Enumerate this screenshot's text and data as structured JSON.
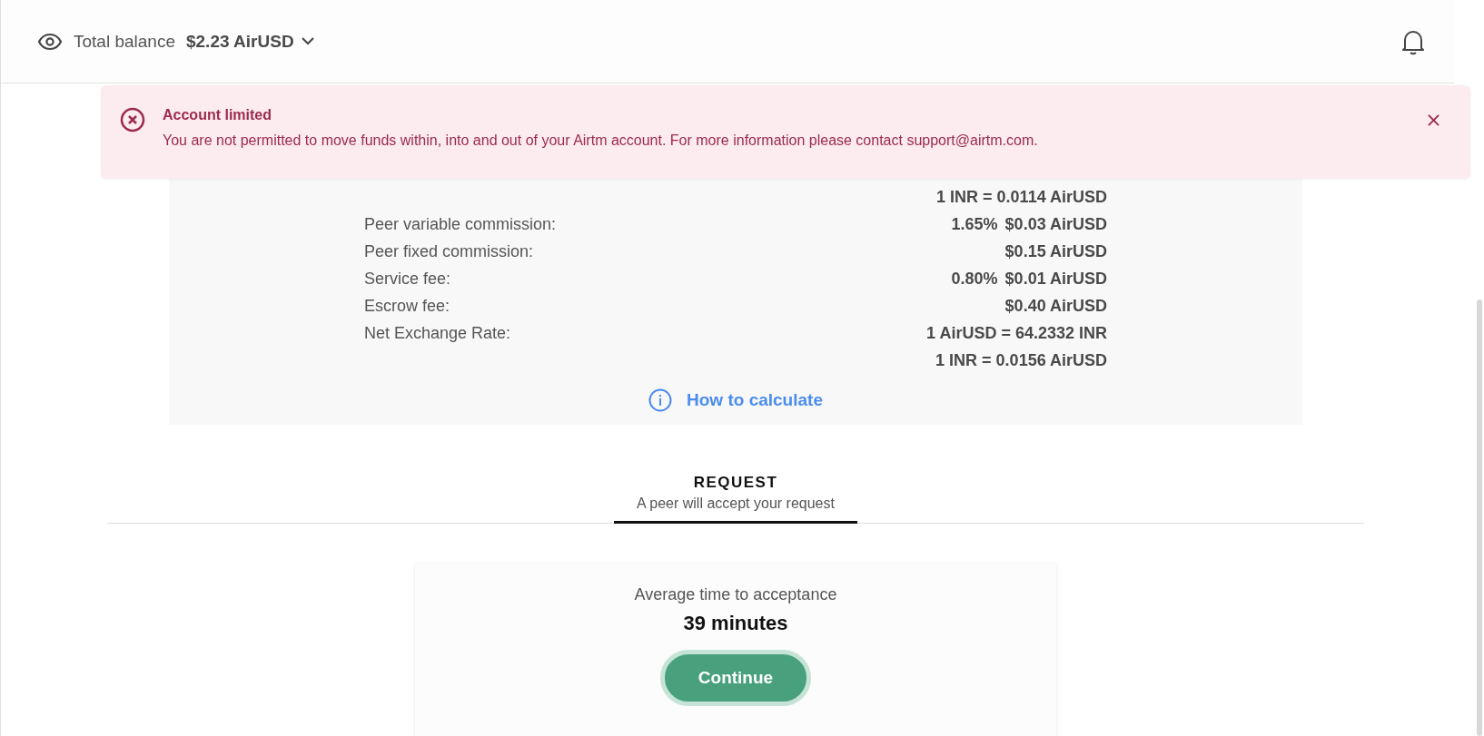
{
  "header": {
    "balance_label": "Total balance",
    "balance_value": "$2.23 AirUSD"
  },
  "alert": {
    "title": "Account limited",
    "message": "You are not permitted to move funds within, into and out of your Airtm account. For more information please contact support@airtm.com."
  },
  "fees": {
    "rows": [
      {
        "label": "",
        "values": [
          "1 INR = 0.0114 AirUSD"
        ]
      },
      {
        "label": "Peer variable commission:",
        "values": [
          "1.65%",
          "$0.03 AirUSD"
        ]
      },
      {
        "label": "Peer fixed commission:",
        "values": [
          "$0.15 AirUSD"
        ]
      },
      {
        "label": "Service fee:",
        "values": [
          "0.80%",
          "$0.01 AirUSD"
        ]
      },
      {
        "label": "Escrow fee:",
        "values": [
          "$0.40 AirUSD"
        ]
      },
      {
        "label": "Net Exchange Rate:",
        "values": [
          "1 AirUSD = 64.2332 INR"
        ]
      },
      {
        "label": "",
        "values": [
          "1 INR = 0.0156 AirUSD"
        ]
      }
    ],
    "link": "How to calculate"
  },
  "tabs": [
    {
      "title": "REQUEST",
      "subtitle": "A peer will accept your request",
      "selected": true
    }
  ],
  "card": {
    "caption": "Average time to acceptance",
    "time": "39 minutes",
    "button": "Continue"
  }
}
